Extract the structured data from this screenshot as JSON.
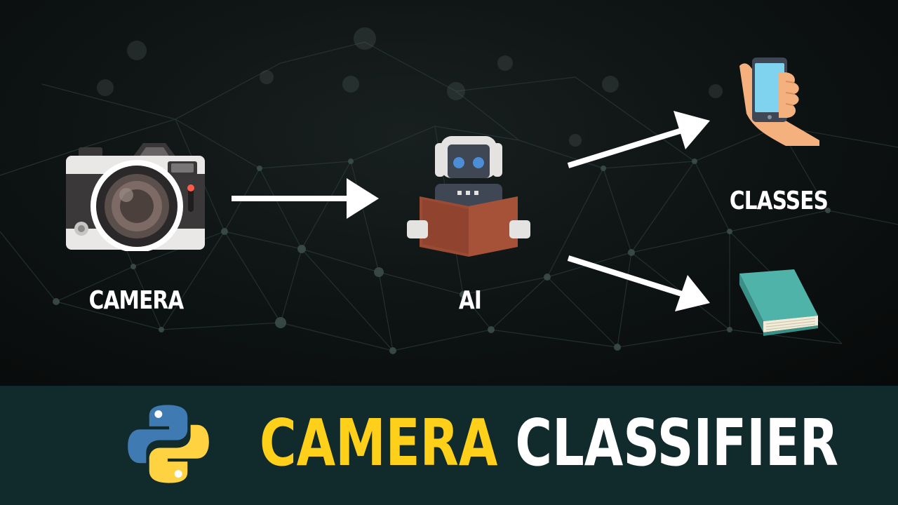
{
  "diagram": {
    "nodes": [
      {
        "id": "camera",
        "label": "CAMERA",
        "icon": "camera-icon"
      },
      {
        "id": "ai",
        "label": "AI",
        "icon": "robot-reading-icon"
      },
      {
        "id": "classes",
        "label": "CLASSES",
        "icons": [
          "phone-in-hand-icon",
          "book-icon"
        ]
      }
    ],
    "edges": [
      {
        "from": "camera",
        "to": "ai"
      },
      {
        "from": "ai",
        "to": "phone-in-hand-icon"
      },
      {
        "from": "ai",
        "to": "book-icon"
      }
    ]
  },
  "banner": {
    "logo": "python-logo-icon",
    "title_word_1": "CAMERA",
    "title_word_2": "CLASSIFIER"
  },
  "colors": {
    "banner_background": "#112a2b",
    "title_accent": "#ffd01a",
    "title_main": "#ffffff",
    "arrow": "#ffffff",
    "python_blue": "#3f7ab3",
    "python_yellow": "#ffd242"
  }
}
